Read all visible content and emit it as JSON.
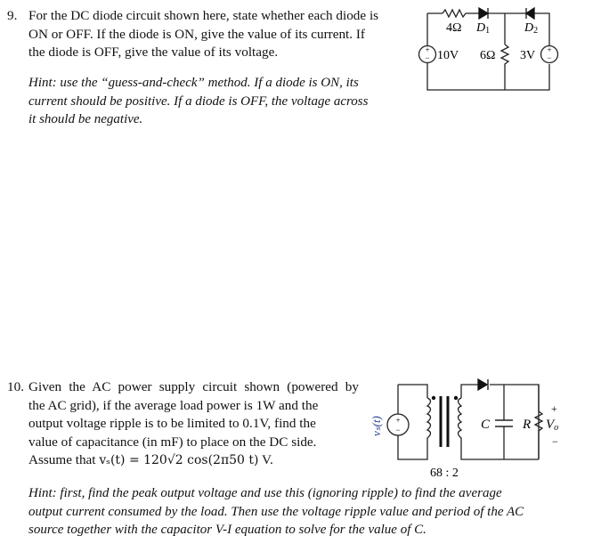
{
  "problems": [
    {
      "number": "9.",
      "text_lines": [
        "For the DC diode circuit shown here, state whether each diode is",
        "ON or OFF. If the diode is ON, give the value of its current. If",
        "the diode is OFF, give the value of its voltage."
      ],
      "hint_lines": [
        "Hint: use the “guess-and-check” method. If a diode is ON, its",
        "current should be positive. If a diode is OFF, the voltage across",
        "it should be negative."
      ],
      "circuit": {
        "r1_label": "4Ω",
        "d1_label": "D",
        "d1_sub": "1",
        "d2_label": "D",
        "d2_sub": "2",
        "source1_label": "10V",
        "r2_label": "6Ω",
        "source2_label": "3V",
        "plus": "+",
        "minus": "−"
      }
    },
    {
      "number": "10.",
      "text_lines": [
        "Given the AC power supply circuit shown (powered by",
        "the AC grid), if the average load power is 1W and the",
        "output voltage ripple is to be limited to 0.1V, find the",
        "value of capacitance (in mF) to place on the DC side."
      ],
      "assume_prefix": "Assume that ",
      "assume_expr": "vₛ(t) = 120√2 cos(2π50 t)",
      "assume_suffix": " V.",
      "hint_lines": [
        "Hint: first, find the peak output voltage and use this (ignoring ripple) to find the average",
        "output current consumed by the load. Then use the voltage ripple value and period of the AC",
        "source together with the capacitor V-I equation to solve for the value of C."
      ],
      "circuit": {
        "source_label": "vₛ(t)",
        "ratio_label": "68 : 2",
        "cap_label": "C",
        "res_label": "R",
        "vo_label": "V",
        "vo_sub": "o",
        "plus": "+",
        "minus": "−"
      }
    }
  ],
  "colors": {
    "text": "#111111",
    "source_label_blue": "#1f3a93"
  }
}
